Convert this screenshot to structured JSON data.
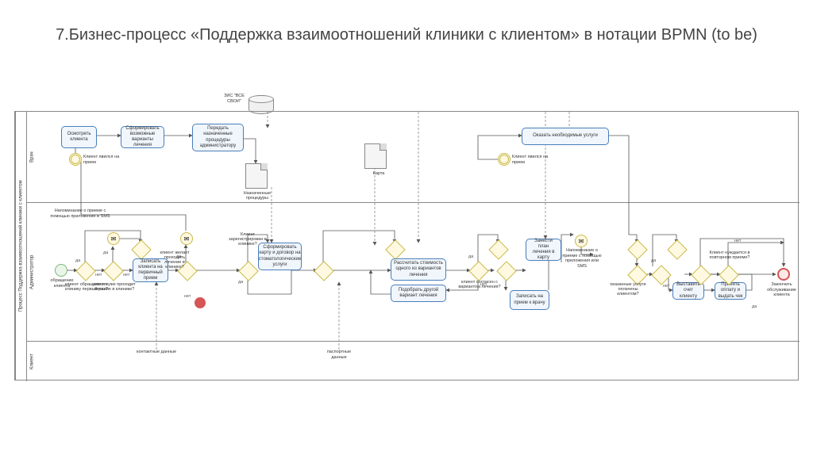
{
  "title": "7.Бизнес-процесс «Поддержка взаимоотношений клиники с клиентом» в нотации BPMN (to be)",
  "pool": "Процесс Поддержка взаимоотношений клиники с клиентом",
  "lanes": {
    "l1": "Врач",
    "l2": "Администратор",
    "l3": "Клиент"
  },
  "db": "ЗИС \"ВСЕ СВОИ\"",
  "tasks": {
    "t1": "Осмотреть клиента",
    "t2": "Сформировать возможные варианты лечения",
    "t3": "Передать назначенные процедуры администратору",
    "t4": "Оказать необходимые услуги",
    "t5": "Записать клиента на первичный прием",
    "t6": "Сформировать карту и договор на стоматологические услуги",
    "t7": "Рассчитать стоимость одного из вариантов лечения",
    "t8": "Подобрать другой вариант лечения",
    "t9": "Занести план лечения в карту",
    "t10": "Записать на прием к врачу",
    "t11": "Выставить счет клиенту",
    "t12": "Принять оплату и выдать чек"
  },
  "gateways": {
    "g1": "клиент обращается в клинику первый раз?",
    "g2": "клиент уже проходит лечение в клинике?",
    "g3": "клиент желает проходить лечение в клинике?",
    "g4": "Клиент зарегистрирован в клинике?",
    "g5": "клиент согласен с вариантом лечения?",
    "g6": "оказанные услуги оплачены клиентом?",
    "g7": "Клиент нуждается в повторном приеме?"
  },
  "events": {
    "e_start": "обращение клиента",
    "e_rem1": "Напоминание о приеме с помощью приложения и SMS",
    "e_rem2": "Напоминание о приеме с помощью приложения или SMS",
    "e_arr1": "Клиент явился на прием",
    "e_arr2": "Клиент явился на прием",
    "e_end": "Закончить обслуживание клиента"
  },
  "docs": {
    "d1": "Назначенные процедуры",
    "d2": "Карта",
    "d3": "контактные данные",
    "d4": "паспортные данные"
  },
  "labels": {
    "yes": "да",
    "no": "нет"
  }
}
